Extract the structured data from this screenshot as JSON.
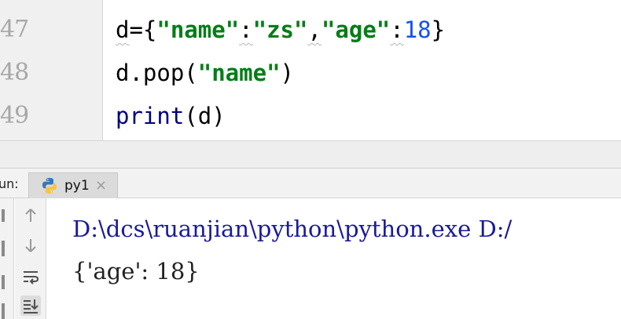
{
  "editor": {
    "line_numbers": [
      "47",
      "48",
      "49"
    ],
    "lines": [
      {
        "tokens": [
          {
            "text": "d",
            "kind": "warn"
          },
          {
            "text": "={",
            "kind": "plain"
          },
          {
            "text": "\"name\"",
            "kind": "str"
          },
          {
            "text": ":",
            "kind": "warn"
          },
          {
            "text": "\"zs\"",
            "kind": "str"
          },
          {
            "text": ",",
            "kind": "warn"
          },
          {
            "text": "\"age\"",
            "kind": "str"
          },
          {
            "text": ":",
            "kind": "warn"
          },
          {
            "text": "18",
            "kind": "num"
          },
          {
            "text": "}",
            "kind": "plain"
          }
        ]
      },
      {
        "tokens": [
          {
            "text": "d.pop(",
            "kind": "plain"
          },
          {
            "text": "\"name\"",
            "kind": "str"
          },
          {
            "text": ")",
            "kind": "plain"
          }
        ]
      },
      {
        "tokens": [
          {
            "text": "print",
            "kind": "builtin"
          },
          {
            "text": "(d)",
            "kind": "plain"
          }
        ]
      }
    ]
  },
  "run_panel": {
    "label": "un:",
    "tab": {
      "title": "py1",
      "icon": "python-icon",
      "close_icon": "close-icon"
    },
    "toolbar": [
      "up-arrow-icon",
      "down-arrow-icon",
      "soft-wrap-icon",
      "scroll-to-end-icon"
    ],
    "console": {
      "command": "D:\\dcs\\ruanjian\\python\\python.exe D:/",
      "output": "{'age': 18}"
    }
  },
  "colors": {
    "string": "#067d17",
    "number": "#1750eb",
    "builtin": "#000080",
    "console_command": "#1a1a9c"
  }
}
